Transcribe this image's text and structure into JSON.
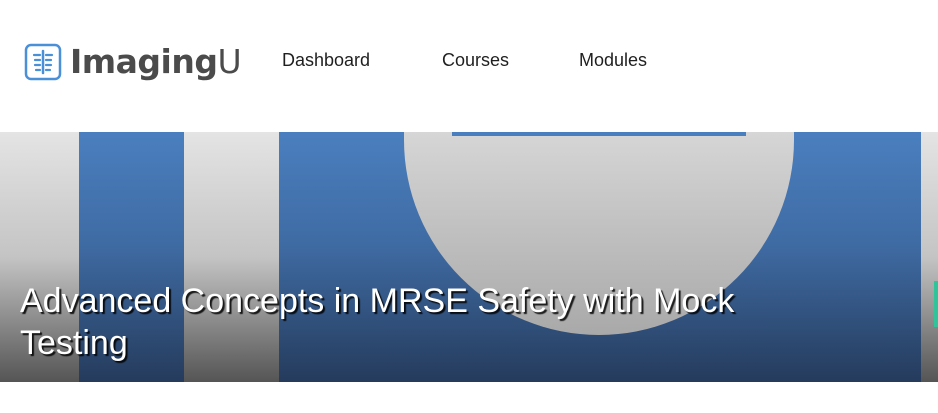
{
  "brand": {
    "name_bold": "Imaging",
    "name_light": "U",
    "icon": "scan-icon",
    "color": "#4a90d9"
  },
  "nav": {
    "items": [
      {
        "label": "Dashboard"
      },
      {
        "label": "Courses"
      },
      {
        "label": "Modules"
      }
    ]
  },
  "hero": {
    "title": "Advanced Concepts in MRSE Safety with Mock Testing",
    "colors": {
      "blue_top": "#4a7fbf",
      "blue_bottom": "#253b5c",
      "gray_top": "#e4e4e4",
      "gray_bottom": "#555555"
    }
  },
  "accent": {
    "green": "#2fc49a"
  }
}
